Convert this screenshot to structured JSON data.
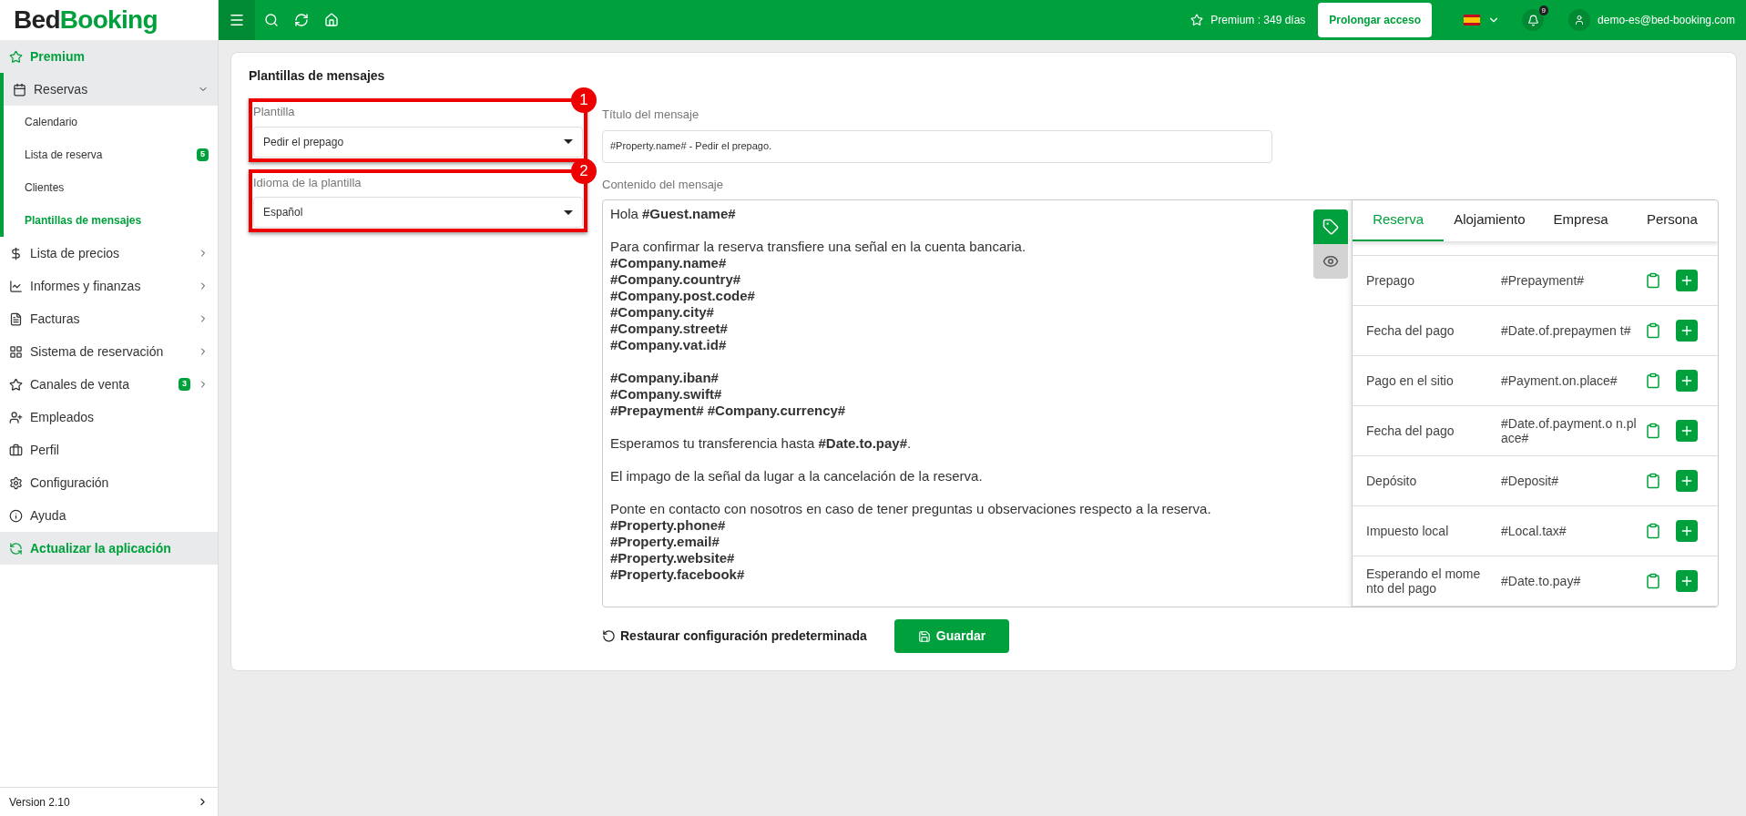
{
  "logo": {
    "part1": "Bed",
    "part2": "Booking"
  },
  "topbar": {
    "premium": "Premium : 349 días",
    "extend_button": "Prolongar acceso",
    "notifications": "9",
    "user": "demo-es@bed-booking.com"
  },
  "sidebar": {
    "items": [
      {
        "label": "Premium",
        "kind": "highlight"
      },
      {
        "label": "Reservas",
        "kind": "group",
        "expanded": true,
        "children": [
          {
            "label": "Calendario",
            "selected": false
          },
          {
            "label": "Lista de reserva",
            "selected": false,
            "badge": "5"
          },
          {
            "label": "Clientes",
            "selected": false
          },
          {
            "label": "Plantillas de mensajes",
            "selected": true
          }
        ]
      },
      {
        "label": "Lista de precios",
        "kind": "group",
        "expanded": false
      },
      {
        "label": "Informes y finanzas",
        "kind": "group",
        "expanded": false
      },
      {
        "label": "Facturas",
        "kind": "group",
        "expanded": false
      },
      {
        "label": "Sistema de reservación",
        "kind": "group",
        "expanded": false
      },
      {
        "label": "Canales de venta",
        "kind": "group",
        "expanded": false,
        "badge": "3"
      },
      {
        "label": "Empleados",
        "kind": "link"
      },
      {
        "label": "Perfil",
        "kind": "link"
      },
      {
        "label": "Configuración",
        "kind": "link"
      },
      {
        "label": "Ayuda",
        "kind": "link"
      },
      {
        "label": "Actualizar la aplicación",
        "kind": "highlight"
      }
    ],
    "version": "Version 2.10"
  },
  "page": {
    "title": "Plantillas de mensajes",
    "template": {
      "label": "Plantilla",
      "value": "Pedir el prepago",
      "marker": "1"
    },
    "language": {
      "label": "Idioma de la plantilla",
      "value": "Español",
      "marker": "2"
    },
    "message_title": {
      "label": "Título del mensaje",
      "value": "#Property.name# - Pedir el prepago."
    },
    "content": {
      "label": "Contenido del mensaje",
      "paragraphs": [
        [
          "Hola **#Guest.name#**"
        ],
        [
          "Para confirmar la reserva transfiere una señal en la cuenta bancaria.",
          "**#Company.name#**",
          "**#Company.country#**",
          "**#Company.post.code#**",
          "**#Company.city#**",
          "**#Company.street#**",
          "**#Company.vat.id#**"
        ],
        [
          "**#Company.iban#**",
          "**#Company.swift#**",
          "**#Prepayment# #Company.currency#**"
        ],
        [
          "Esperamos tu transferencia hasta **#Date.to.pay#**."
        ],
        [
          "El impago de la señal da lugar a la cancelación de la reserva."
        ],
        [
          "Ponte en contacto con nosotros en caso de tener preguntas u observaciones respecto a la reserva.",
          "**#Property.phone#**",
          "**#Property.email#**",
          "**#Property.website#**",
          "**#Property.facebook#**"
        ]
      ]
    },
    "tags_panel": {
      "tabs": [
        {
          "label": "Reserva",
          "selected": true
        },
        {
          "label": "Alojamiento",
          "selected": false
        },
        {
          "label": "Empresa",
          "selected": false
        },
        {
          "label": "Persona",
          "selected": false
        }
      ],
      "rows": [
        {
          "label": "Prepago",
          "tag": "#Prepayment#"
        },
        {
          "label": "Fecha del pago",
          "tag": "#Date.of.prepaymen t#"
        },
        {
          "label": "Pago en el sitio",
          "tag": "#Payment.on.place#"
        },
        {
          "label": "Fecha del pago",
          "tag": "#Date.of.payment.o n.place#"
        },
        {
          "label": "Depósito",
          "tag": "#Deposit#"
        },
        {
          "label": "Impuesto local",
          "tag": "#Local.tax#"
        },
        {
          "label": "Esperando el mome nto del pago",
          "tag": "#Date.to.pay#"
        }
      ]
    },
    "restore_button": "Restaurar configuración predeterminada",
    "save_button": "Guardar"
  }
}
